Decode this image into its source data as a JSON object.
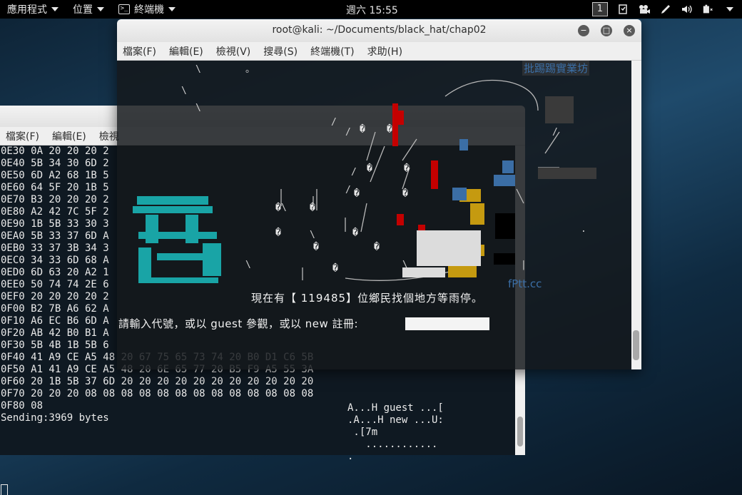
{
  "topbar": {
    "applications": "應用程式",
    "places": "位置",
    "terminal_app": "終端機",
    "clock": "週六 15:55",
    "workspace": "1"
  },
  "back_window": {
    "menu": [
      "檔案(F)",
      "編輯(E)",
      "檢視"
    ],
    "hex_lines": [
      "0E30 0A 20 20 20 2",
      "0E40 5B 34 30 6D 2",
      "0E50 6D A2 68 1B 5",
      "0E60 64 5F 20 1B 5",
      "0E70 B3 20 20 20 2",
      "0E80 A2 42 7C 5F 2",
      "0E90 1B 5B 33 30 3",
      "0EA0 5B 33 37 6D A",
      "0EB0 33 37 3B 34 3",
      "0EC0 34 33 6D 68 A",
      "0ED0 6D 63 20 A2 1",
      "0EE0 50 74 74 2E 6",
      "0EF0 20 20 20 20 2",
      "0F00 B2 7B A6 62 A",
      "0F10 A6 EC B6 6D A",
      "0F20 AB 42 B0 B1 A",
      "0F30 5B 4B 1B 5B 6",
      "0F40 41 A9 CE A5 48 20 67 75 65 73 74 20 B0 D1 C6 5B",
      "0F50 A1 41 A9 CE A5 48 20 6E 65 77 20 B5 F9 A5 55 3A",
      "0F60 20 1B 5B 37 6D 20 20 20 20 20 20 20 20 20 20 20",
      "0F70 20 20 20 08 08 08 08 08 08 08 08 08 08 08 08 08",
      "0F80 08",
      "Sending:3969 bytes"
    ],
    "ascii_lines": [
      "A...H guest ...[",
      ".A...H new ...U:",
      " .[7m",
      "   ............",
      "."
    ]
  },
  "front_window": {
    "title": "root@kali: ~/Documents/black_hat/chap02",
    "menu": [
      "檔案(F)",
      "編輯(E)",
      "檢視(V)",
      "搜尋(S)",
      "終端機(T)",
      "求助(H)"
    ],
    "banner": "批踢踢實業坊",
    "site_tag": "fPtt.cc",
    "online_message": "現在有【 119485】位鄉民找個地方等雨停。",
    "login_prompt": "請輸入代號，或以 guest 參觀，或以 new 註冊:"
  }
}
